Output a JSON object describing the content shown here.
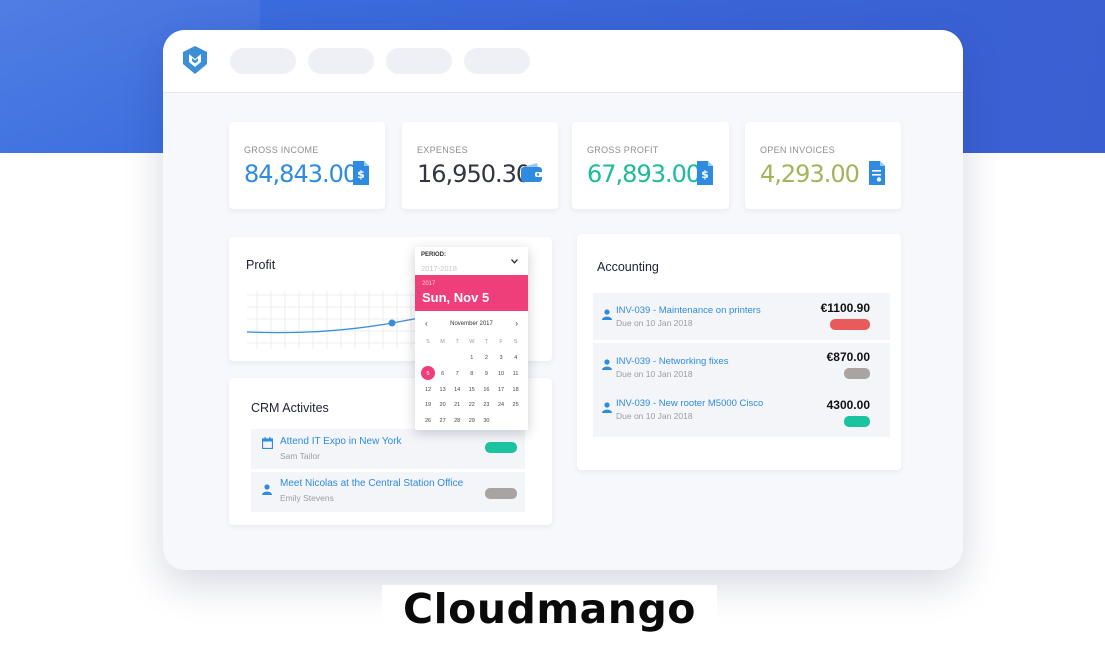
{
  "stats": [
    {
      "label": "GROSS INCOME",
      "value": "84,843.00",
      "color": "#2e8be0",
      "icon": "invoice-dollar-icon"
    },
    {
      "label": "EXPENSES",
      "value": "16,950.30",
      "color": "#333640",
      "icon": "wallet-icon"
    },
    {
      "label": "GROSS PROFIT",
      "value": "67,893.00",
      "color": "#1bbc9b",
      "icon": "invoice-dollar-icon"
    },
    {
      "label": "OPEN INVOICES",
      "value": "4,293.00",
      "color": "#a5b35a",
      "icon": "invoice-icon"
    }
  ],
  "profit": {
    "title": "Profit"
  },
  "period": {
    "label": "PERIOD:",
    "value": "2017-2018",
    "selected_year": "2017",
    "selected_date": "Sun, Nov 5",
    "month": "November 2017",
    "weekdays": [
      "S",
      "M",
      "T",
      "W",
      "T",
      "F",
      "S"
    ],
    "days": [
      "",
      "",
      "",
      "1",
      "2",
      "3",
      "4",
      "5",
      "6",
      "7",
      "8",
      "9",
      "10",
      "11",
      "12",
      "13",
      "14",
      "15",
      "16",
      "17",
      "18",
      "19",
      "20",
      "21",
      "22",
      "23",
      "24",
      "25",
      "26",
      "27",
      "28",
      "29",
      "30"
    ],
    "selected_day": "5",
    "accent": "#ef3f7a"
  },
  "accounting": {
    "title": "Accounting",
    "rows": [
      {
        "name": "INV-039 - Maintenance on printers",
        "due": "Due on 10 Jan 2018",
        "amount": "€1100.90",
        "status_color": "#e95b5b"
      },
      {
        "name": "INV-039 - Networking fixes",
        "due": "Due on 10 Jan 2018",
        "amount": "€870.00",
        "status_color": "#a9a3a1"
      },
      {
        "name": "INV-039 - New rooter M5000 Cisco",
        "due": "Due on 10 Jan 2018",
        "amount": "4300.00",
        "status_color": "#1bc3a0"
      }
    ]
  },
  "crm": {
    "title": "CRM Activites",
    "rows": [
      {
        "name": "Attend IT Expo in New York",
        "person": "Sam Tailor",
        "icon": "calendar-icon",
        "status_color": "#1bc3a0"
      },
      {
        "name": "Meet Nicolas at the Central Station Office",
        "person": "Emily Stevens",
        "icon": "person-icon",
        "status_color": "#a9a3a1"
      }
    ]
  },
  "brand": {
    "name": "Cloudmango"
  }
}
